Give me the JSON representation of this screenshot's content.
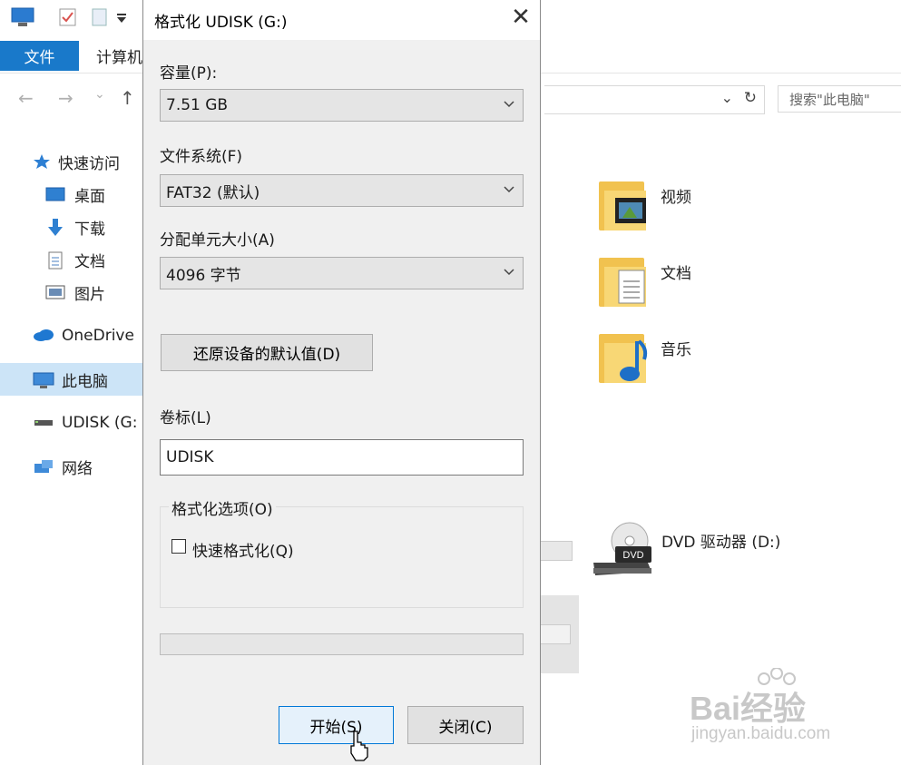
{
  "explorer": {
    "ribbon": {
      "file_tab": "文件",
      "computer_tab": "计算机"
    },
    "search": {
      "placeholder": "搜索\"此电脑\""
    },
    "sidebar": {
      "items": [
        {
          "label": "快速访问"
        },
        {
          "label": "桌面"
        },
        {
          "label": "下载"
        },
        {
          "label": "文档"
        },
        {
          "label": "图片"
        },
        {
          "label": "OneDrive"
        },
        {
          "label": "此电脑"
        },
        {
          "label": "UDISK (G:"
        },
        {
          "label": "网络"
        }
      ]
    },
    "folders": [
      {
        "label": "视频"
      },
      {
        "label": "文档"
      },
      {
        "label": "音乐"
      }
    ],
    "drives": [
      {
        "label": "DVD 驱动器 (D:)",
        "badge": "DVD"
      }
    ]
  },
  "dialog": {
    "title": "格式化 UDISK (G:)",
    "capacity_label": "容量(P):",
    "capacity_value": "7.51 GB",
    "filesystem_label": "文件系统(F)",
    "filesystem_value": "FAT32 (默认)",
    "allocation_label": "分配单元大小(A)",
    "allocation_value": "4096 字节",
    "restore_defaults_button": "还原设备的默认值(D)",
    "volume_label_label": "卷标(L)",
    "volume_label_value": "UDISK",
    "format_options_label": "格式化选项(O)",
    "quick_format_label": "快速格式化(Q)",
    "quick_format_checked": false,
    "progress": 0,
    "start_button": "开始(S)",
    "close_button": "关闭(C)"
  },
  "watermark": {
    "brand": "Bai经验",
    "url": "jingyan.baidu.com"
  },
  "colors": {
    "accent": "#1979ca",
    "dialog_bg": "#f0f0f0",
    "selected_nav": "#cce4f7"
  }
}
